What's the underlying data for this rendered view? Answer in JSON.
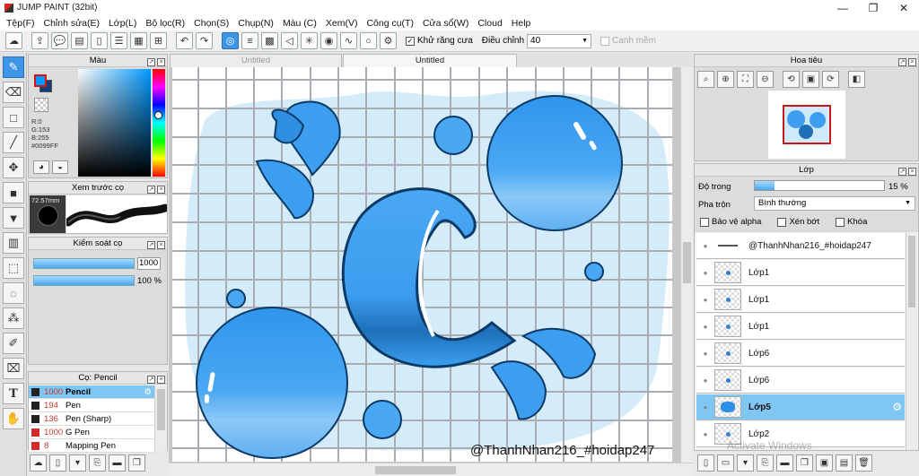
{
  "window": {
    "title": "JUMP PAINT (32bit)",
    "minimize": "—",
    "maximize": "❐",
    "close": "✕"
  },
  "menu": [
    "Tệp(F)",
    "Chỉnh sửa(E)",
    "Lớp(L)",
    "Bộ lọc(R)",
    "Chọn(S)",
    "Chụp(N)",
    "Màu (C)",
    "Xem(V)",
    "Công cụ(T)",
    "Cửa sổ(W)",
    "Cloud",
    "Help"
  ],
  "toolbar": {
    "antialias_label": "Khử răng cưa",
    "adjust_label": "Điều chỉnh",
    "adjust_value": "40",
    "snap_label": "Canh mềm"
  },
  "color_panel": {
    "title": "Màu",
    "rgb_r": "R:0",
    "rgb_g": "G:153",
    "rgb_b": "B:255",
    "hex": "#0099FF",
    "fg_color": "#0099ff"
  },
  "brush_preview": {
    "title": "Xem trước cọ",
    "size": "72.57mm"
  },
  "brush_control": {
    "title": "Kiểm soát cọ",
    "size_value": "1000",
    "opacity_value": "100 %"
  },
  "brush_list": {
    "title": "Cọ: Pencil",
    "items": [
      {
        "size": "1000",
        "name": "Pencil",
        "selected": true
      },
      {
        "size": "194",
        "name": "Pen"
      },
      {
        "size": "136",
        "name": "Pen (Sharp)"
      },
      {
        "size": "1000",
        "name": "G Pen"
      },
      {
        "size": "8",
        "name": "Mapping Pen"
      }
    ]
  },
  "canvas": {
    "tabs": [
      "Untitled",
      "Untitled"
    ],
    "watermark": "@ThanhNhan216_#hoidap247"
  },
  "navigator": {
    "title": "Hoa tiêu"
  },
  "layers": {
    "title": "Lớp",
    "opacity_label": "Độ trong",
    "opacity_value": "15 %",
    "opacity_fraction": 0.15,
    "blend_label": "Pha trộn",
    "blend_value": "Bình thường",
    "protect_alpha_label": "Bảo vệ alpha",
    "clip_label": "Xén bớt",
    "lock_label": "Khóa",
    "items": [
      {
        "name": "@ThanhNhan216_#hoidap247"
      },
      {
        "name": "Lớp1"
      },
      {
        "name": "Lớp1"
      },
      {
        "name": "Lớp1"
      },
      {
        "name": "Lớp6"
      },
      {
        "name": "Lớp6"
      },
      {
        "name": "Lớp5",
        "selected": true
      },
      {
        "name": "Lớp2"
      }
    ],
    "activate_text": "Activate Windows"
  }
}
